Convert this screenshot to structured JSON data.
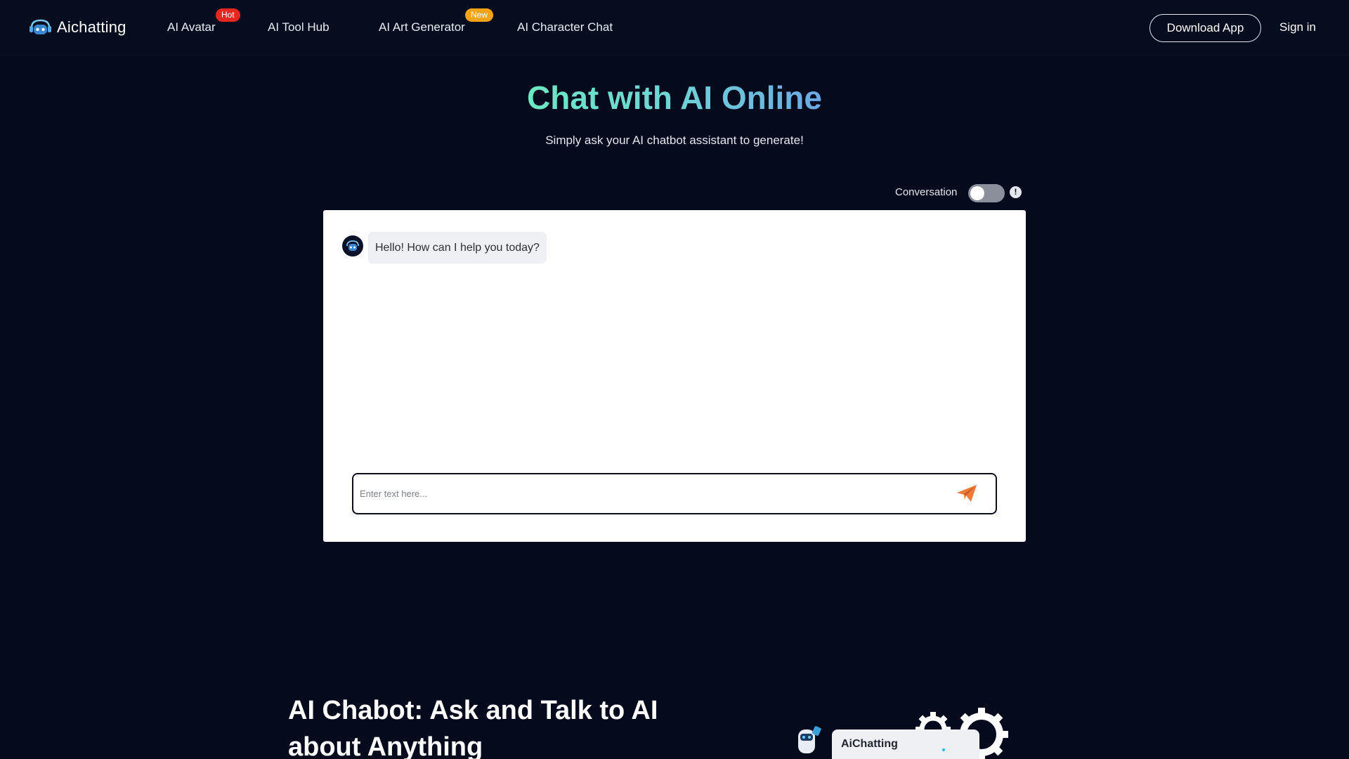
{
  "header": {
    "logo_text": "Aichatting",
    "nav": [
      {
        "label": "AI Avatar",
        "badge": "Hot"
      },
      {
        "label": "AI Tool Hub"
      },
      {
        "label": "AI Art Generator",
        "badge": "New"
      },
      {
        "label": "AI Character Chat"
      }
    ],
    "download_label": "Download App",
    "signin_label": "Sign in"
  },
  "hero": {
    "title": "Chat with AI Online",
    "subtitle": "Simply ask your AI chatbot assistant to generate!"
  },
  "conversation": {
    "label": "Conversation",
    "enabled": false,
    "info_glyph": "!"
  },
  "chat": {
    "messages": [
      {
        "sender": "bot",
        "text": "Hello! How can I help you today?"
      }
    ],
    "input_placeholder": "Enter text here...",
    "input_value": "",
    "send_icon": "paper-plane-icon"
  },
  "section": {
    "title": "AI Chabot: Ask and Talk to AI about Anything"
  },
  "illustration": {
    "card_title": "AiChatting"
  },
  "colors": {
    "background": "#050b1c",
    "hot_badge": "#e5281f",
    "new_badge": "#f2a316",
    "send_icon": "#f07a3a",
    "title_gradient_start": "#6ce8c2",
    "title_gradient_end": "#6ba8e6"
  }
}
